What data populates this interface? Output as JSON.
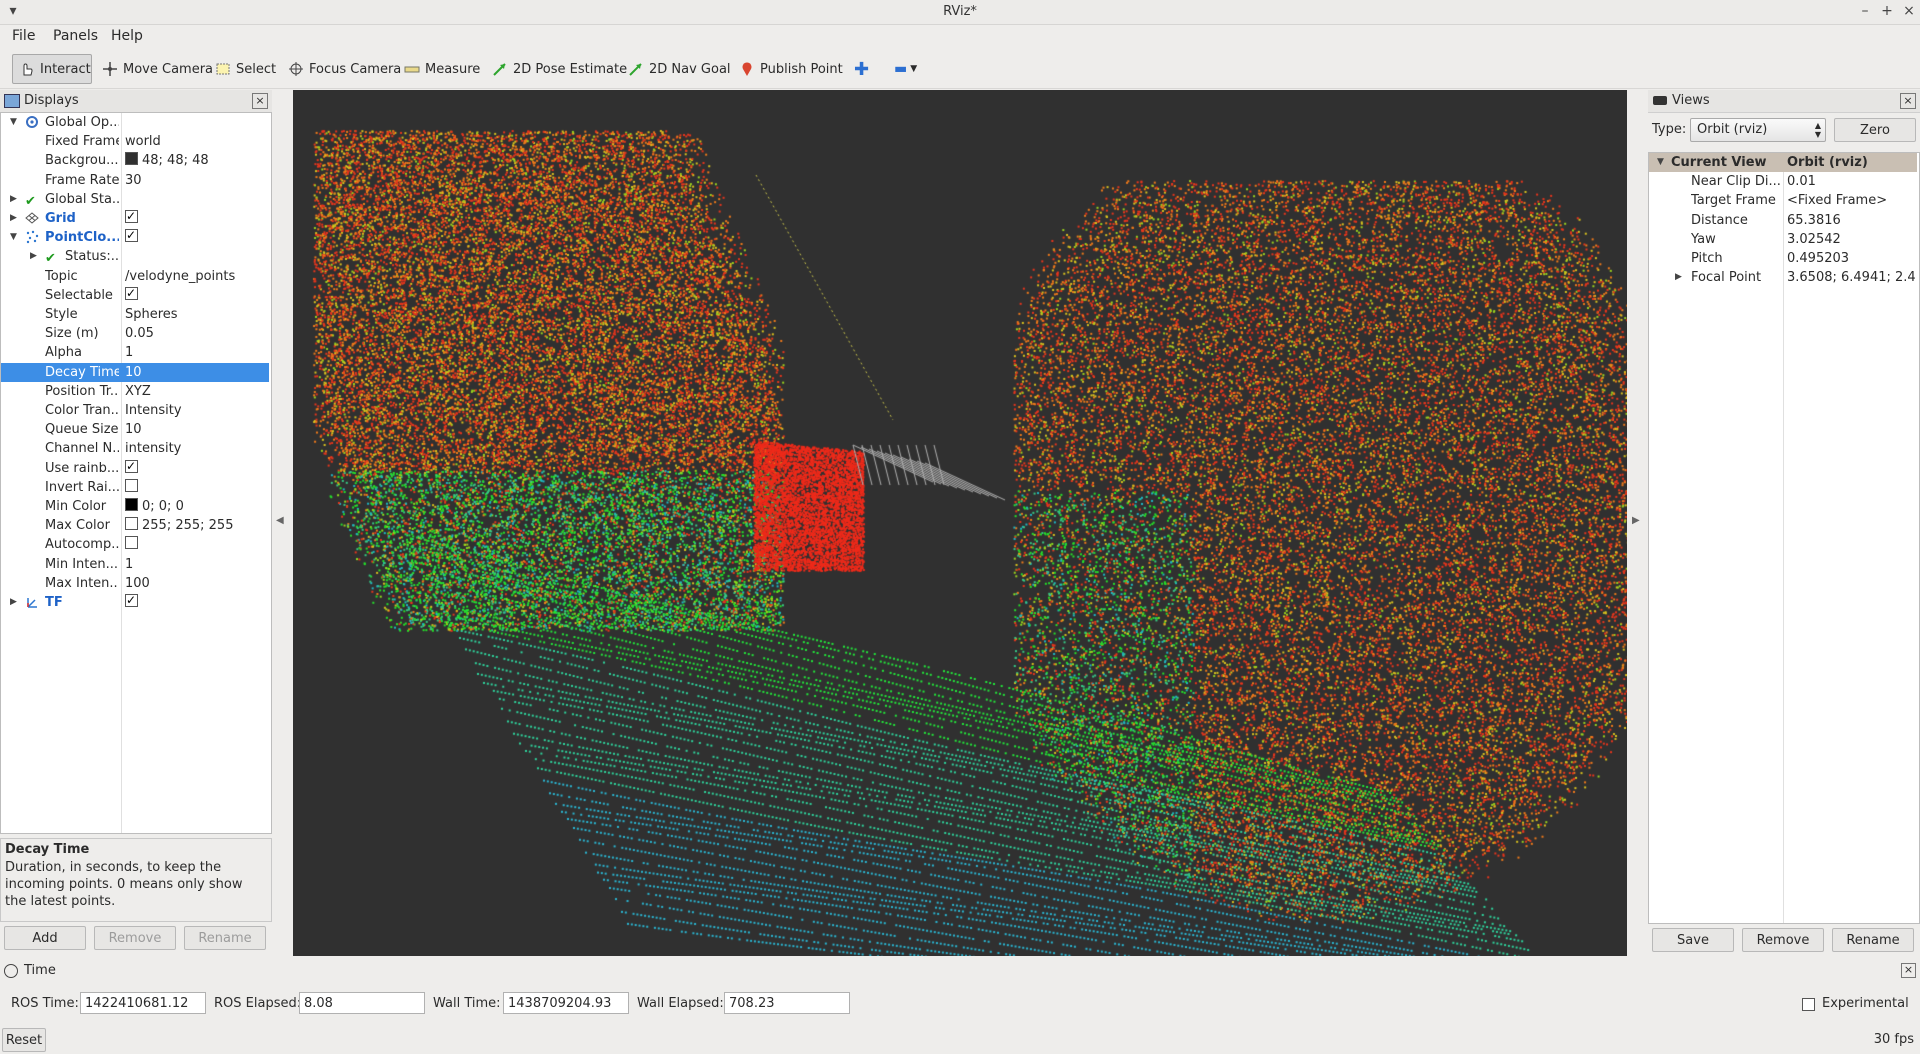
{
  "window": {
    "title": "RViz*"
  },
  "menu": [
    "File",
    "Panels",
    "Help"
  ],
  "toolbar": {
    "interact": "Interact",
    "move_camera": "Move Camera",
    "select": "Select",
    "focus_camera": "Focus Camera",
    "measure": "Measure",
    "pose_estimate": "2D Pose Estimate",
    "nav_goal": "2D Nav Goal",
    "publish_point": "Publish Point"
  },
  "displays": {
    "title": "Displays",
    "rows": [
      {
        "indent": 0,
        "arrow": "down",
        "icon": "gear-icon",
        "key": "Global Op...",
        "value": ""
      },
      {
        "indent": 1,
        "key": "Fixed Frame",
        "value": "world"
      },
      {
        "indent": 1,
        "key": "Backgrou...",
        "value": "48; 48; 48",
        "swatch": "#303030"
      },
      {
        "indent": 1,
        "key": "Frame Rate",
        "value": "30"
      },
      {
        "indent": 0,
        "arrow": "right",
        "icon": "check-icon",
        "key": "Global Sta...",
        "value": ""
      },
      {
        "indent": 0,
        "arrow": "right",
        "icon": "grid-icon",
        "key": "Grid",
        "blue": true,
        "check": true
      },
      {
        "indent": 0,
        "arrow": "down",
        "icon": "pointcloud-icon",
        "key": "PointClo...",
        "blue": true,
        "check": true
      },
      {
        "indent": 1,
        "arrow": "right",
        "icon": "check-icon",
        "key": "Status:...",
        "value": ""
      },
      {
        "indent": 1,
        "key": "Topic",
        "value": "/velodyne_points"
      },
      {
        "indent": 1,
        "key": "Selectable",
        "check": true
      },
      {
        "indent": 1,
        "key": "Style",
        "value": "Spheres"
      },
      {
        "indent": 1,
        "key": "Size (m)",
        "value": "0.05"
      },
      {
        "indent": 1,
        "key": "Alpha",
        "value": "1"
      },
      {
        "indent": 1,
        "key": "Decay Time",
        "value": "10",
        "selected": true
      },
      {
        "indent": 1,
        "key": "Position Tr...",
        "value": "XYZ"
      },
      {
        "indent": 1,
        "key": "Color Tran...",
        "value": "Intensity"
      },
      {
        "indent": 1,
        "key": "Queue Size",
        "value": "10"
      },
      {
        "indent": 1,
        "key": "Channel N...",
        "value": "intensity"
      },
      {
        "indent": 1,
        "key": "Use rainb...",
        "check": true
      },
      {
        "indent": 1,
        "key": "Invert Rai...",
        "check": false
      },
      {
        "indent": 1,
        "key": "Min Color",
        "value": "0; 0; 0",
        "swatch": "#000000"
      },
      {
        "indent": 1,
        "key": "Max Color",
        "value": "255; 255; 255",
        "swatch": "#ffffff"
      },
      {
        "indent": 1,
        "key": "Autocomp...",
        "check": false
      },
      {
        "indent": 1,
        "key": "Min Inten...",
        "value": "1"
      },
      {
        "indent": 1,
        "key": "Max Inten...",
        "value": "100"
      },
      {
        "indent": 0,
        "arrow": "right",
        "icon": "tf-icon",
        "key": "TF",
        "blue": true,
        "check": true
      }
    ],
    "help_title": "Decay Time",
    "help_text": "Duration, in seconds, to keep the incoming points. 0 means only show the latest points.",
    "buttons": {
      "add": "Add",
      "remove": "Remove",
      "rename": "Rename"
    }
  },
  "views": {
    "title": "Views",
    "type_label": "Type:",
    "type_value": "Orbit (rviz)",
    "zero": "Zero",
    "header": {
      "key": "Current View",
      "value": "Orbit (rviz)"
    },
    "rows": [
      {
        "key": "Near Clip Di...",
        "value": "0.01"
      },
      {
        "key": "Target Frame",
        "value": "<Fixed Frame>"
      },
      {
        "key": "Distance",
        "value": "65.3816"
      },
      {
        "key": "Yaw",
        "value": "3.02542"
      },
      {
        "key": "Pitch",
        "value": "0.495203"
      },
      {
        "key": "Focal Point",
        "value": "3.6508; 6.4941; 2.4...",
        "arrow": true
      }
    ],
    "buttons": {
      "save": "Save",
      "remove": "Remove",
      "rename": "Rename"
    }
  },
  "time": {
    "title": "Time",
    "ros_time_label": "ROS Time:",
    "ros_time": "1422410681.12",
    "ros_elapsed_label": "ROS Elapsed:",
    "ros_elapsed": "8.08",
    "wall_time_label": "Wall Time:",
    "wall_time": "1438709204.93",
    "wall_elapsed_label": "Wall Elapsed:",
    "wall_elapsed": "708.23",
    "experimental": "Experimental"
  },
  "status": {
    "reset": "Reset",
    "fps": "30 fps"
  },
  "colors": {
    "viewport_bg": "#303030",
    "selection": "#3d8ee6",
    "link_blue": "#1e62c7"
  }
}
